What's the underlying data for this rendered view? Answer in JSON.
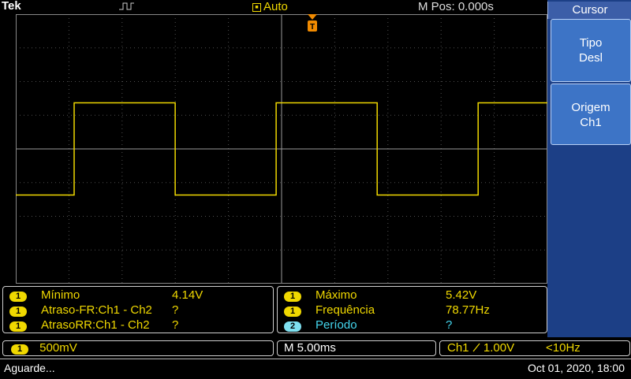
{
  "top": {
    "brand": "Tek",
    "trigger_mode": "Auto",
    "trigger_mode_icon": "trigger-square-icon",
    "m_pos": "M Pos: 0.000s"
  },
  "menu": {
    "title": "Cursor",
    "buttons": [
      {
        "line1": "Tipo",
        "line2": "Desl"
      },
      {
        "line1": "Origem",
        "line2": "Ch1"
      }
    ]
  },
  "measurements": {
    "left": [
      {
        "channel": "1",
        "label": "Mínimo",
        "value": "4.14V"
      },
      {
        "channel": "1",
        "label": "Atraso-FR:Ch1 - Ch2",
        "value": "?"
      },
      {
        "channel": "1",
        "label": "AtrasoRR:Ch1 - Ch2",
        "value": "?"
      }
    ],
    "right": [
      {
        "channel": "1",
        "label": "Máximo",
        "value": "5.42V"
      },
      {
        "channel": "1",
        "label": "Frequência",
        "value": "78.77Hz"
      },
      {
        "channel": "2",
        "label": "Período",
        "value": "?"
      }
    ]
  },
  "status": {
    "ch1_channel": "1",
    "ch1_scale": "500mV",
    "timebase": "M 5.00ms",
    "trigger_source": "Ch1",
    "trigger_slope_icon": "rising-edge-icon",
    "trigger_level": "1.00V",
    "trigger_freq": "<10Hz",
    "message": "Aguarde...",
    "datetime": "Oct 01, 2020, 18:00"
  },
  "colors": {
    "ch1": "#f0d800",
    "ch2": "#44d6ee",
    "menu_bg": "#1c3f86",
    "menu_button": "#3d74c6"
  },
  "waveform": {
    "type": "square",
    "high_level_div": 0.95,
    "low_level_div": -0.95,
    "period_div": 3.8,
    "first_rising_div": 3.7
  }
}
